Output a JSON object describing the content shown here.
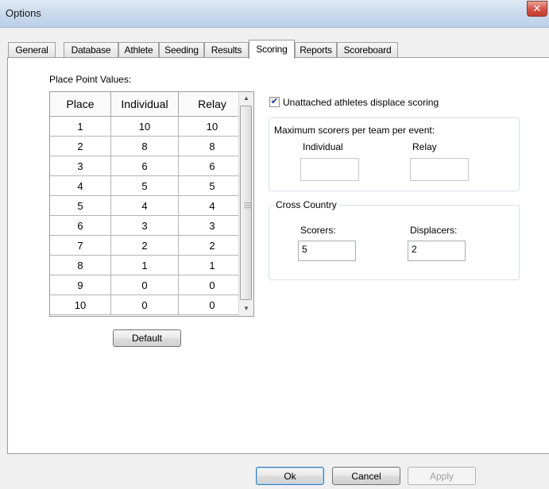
{
  "window": {
    "title": "Options",
    "close_glyph": "✕",
    "close_icon": "close-icon"
  },
  "tabs": [
    {
      "label": "General"
    },
    {
      "label": "Database"
    },
    {
      "label": "Athlete"
    },
    {
      "label": "Seeding"
    },
    {
      "label": "Results"
    },
    {
      "label": "Scoring"
    },
    {
      "label": "Reports"
    },
    {
      "label": "Scoreboard"
    }
  ],
  "active_tab": "Scoring",
  "scoring": {
    "place_point_label": "Place Point Values:",
    "columns": [
      "Place",
      "Individual",
      "Relay"
    ],
    "rows": [
      [
        "1",
        "10",
        "10"
      ],
      [
        "2",
        "8",
        "8"
      ],
      [
        "3",
        "6",
        "6"
      ],
      [
        "4",
        "5",
        "5"
      ],
      [
        "5",
        "4",
        "4"
      ],
      [
        "6",
        "3",
        "3"
      ],
      [
        "7",
        "2",
        "2"
      ],
      [
        "8",
        "1",
        "1"
      ],
      [
        "9",
        "0",
        "0"
      ],
      [
        "10",
        "0",
        "0"
      ]
    ],
    "default_button": "Default",
    "unattached_label": "Unattached athletes displace scoring",
    "unattached_checked": true,
    "max_scorers": {
      "label": "Maximum scorers per team per event:",
      "individual_label": "Individual",
      "individual_value": "",
      "relay_label": "Relay",
      "relay_value": ""
    },
    "cross_country": {
      "label": "Cross Country",
      "scorers_label": "Scorers:",
      "scorers_value": "5",
      "displacers_label": "Displacers:",
      "displacers_value": "2"
    }
  },
  "footer": {
    "ok": "Ok",
    "cancel": "Cancel",
    "apply": "Apply"
  }
}
